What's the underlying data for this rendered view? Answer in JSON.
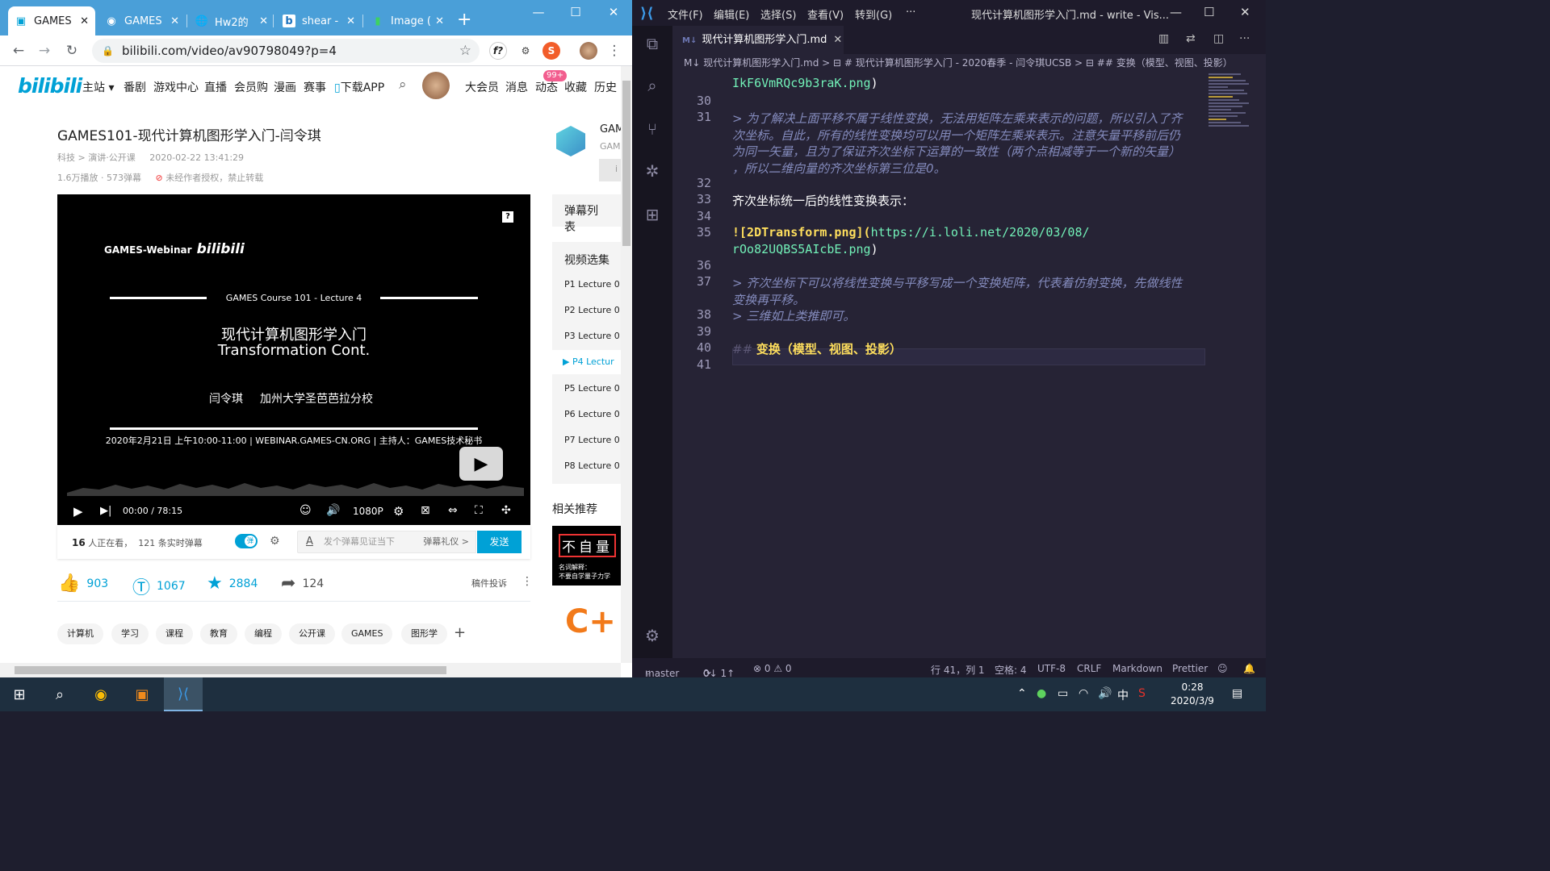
{
  "browser": {
    "tabs": [
      {
        "label": "GAMES",
        "icon": "bilibili-icon",
        "active": true
      },
      {
        "label": "GAMES",
        "icon": "eye-icon"
      },
      {
        "label": "Hw2的",
        "icon": "globe-icon"
      },
      {
        "label": "shear -",
        "icon": "bing-icon"
      },
      {
        "label": "Image (",
        "icon": "chart-icon"
      }
    ],
    "url": "bilibili.com/video/av90798049?p=4",
    "ext_f": "f?",
    "ext_s": "S"
  },
  "site": {
    "logo": "bilibili",
    "nav": [
      "主站",
      "番剧",
      "游戏中心",
      "直播",
      "会员购",
      "漫画",
      "赛事",
      "下载APP"
    ],
    "right_nav": [
      "大会员",
      "消息",
      "动态",
      "收藏",
      "历史"
    ],
    "badge": "99+"
  },
  "video": {
    "title": "GAMES101-现代计算机图形学入门-闫令琪",
    "category": "科技 > 演讲·公开课",
    "date": "2020-02-22 13:41:29",
    "stats": "1.6万播放 · 573弹幕",
    "warning": "未经作者授权，禁止转载"
  },
  "player": {
    "webinar": "GAMES-Webinar",
    "webinar_logo": "bilibili",
    "course": "GAMES Course 101 - Lecture 4",
    "title_cn": "现代计算机图形学入门",
    "title_en": "Transformation Cont.",
    "author": "闫令琪",
    "univ": "加州大学圣芭芭拉分校",
    "info": "2020年2月21日 上午10:00-11:00 | WEBINAR.GAMES-CN.ORG | 主持人：GAMES技术秘书",
    "time": "00:00 / 78:15",
    "quality": "1080P",
    "help": "?"
  },
  "danmaku": {
    "watching_count": "16",
    "watching_label": " 人正在看，",
    "realtime": "121 条实时弹幕",
    "toggle": "弹",
    "placeholder": "发个弹幕见证当下",
    "etiquette": "弹幕礼仪 >",
    "send": "发送"
  },
  "actions": {
    "like": "903",
    "coin": "1067",
    "fav": "2884",
    "share": "124",
    "report": "稿件投诉"
  },
  "tags": [
    "计算机",
    "学习",
    "课程",
    "教育",
    "编程",
    "公开课",
    "GAMES",
    "图形学"
  ],
  "sidebar": {
    "up_name": "GAM",
    "up_sub": "GAM",
    "follow": "i",
    "danmaku_list": "弹幕列表",
    "episodes_title": "视频选集",
    "episodes": [
      {
        "label": "P1  Lecture 0"
      },
      {
        "label": "P2  Lecture 0"
      },
      {
        "label": "P3  Lecture 0"
      },
      {
        "label": "▶ P4  Lectur",
        "current": true
      },
      {
        "label": "P5  Lecture 0"
      },
      {
        "label": "P6  Lecture 0"
      },
      {
        "label": "P7  Lecture 0"
      },
      {
        "label": "P8  Lecture 0"
      }
    ],
    "related": "相关推荐",
    "related_thumb_big": "不自量",
    "related_thumb_small": "名词解释：\n不要自学量子力学",
    "related_logo": "C+"
  },
  "vscode": {
    "menu": [
      "文件(F)",
      "编辑(E)",
      "选择(S)",
      "查看(V)",
      "转到(G)",
      "···"
    ],
    "window_title": "现代计算机图形学入门.md - write - Vis...",
    "tab": "现代计算机图形学入门.md",
    "tab_prefix": "M↓",
    "breadcrumb": "M↓ 现代计算机图形学入门.md > ⊟ # 现代计算机图形学入门 - 2020春季 - 闫令琪UCSB > ⊟ ## 变换（模型、视图、投影）",
    "lines": [
      {
        "n": "",
        "parts": [
          {
            "t": "IkF6VmRQc9b3raK.png",
            "c": "link"
          },
          {
            "t": ")",
            "c": "plain mono"
          }
        ]
      },
      {
        "n": "30",
        "parts": []
      },
      {
        "n": "31",
        "parts": [
          {
            "t": "> 为了解决上面平移不属于线性变换，无法用矩阵左乘来表示的问题，所以引入了齐",
            "c": "quote"
          }
        ]
      },
      {
        "n": "",
        "parts": [
          {
            "t": "次坐标。自此，所有的线性变换均可以用一个矩阵左乘来表示。注意矢量平移前后仍",
            "c": "quote"
          }
        ]
      },
      {
        "n": "",
        "parts": [
          {
            "t": "为同一矢量，且为了保证齐次坐标下运算的一致性（两个点相减等于一个新的矢量）",
            "c": "quote"
          }
        ]
      },
      {
        "n": "",
        "parts": [
          {
            "t": "，所以二维向量的齐次坐标第三位是0。",
            "c": "quote"
          }
        ]
      },
      {
        "n": "32",
        "parts": []
      },
      {
        "n": "33",
        "parts": [
          {
            "t": "齐次坐标统一后的线性变换表示：",
            "c": "plain"
          }
        ]
      },
      {
        "n": "34",
        "parts": []
      },
      {
        "n": "35",
        "parts": [
          {
            "t": "![2DTransform.png](",
            "c": "hdr mono"
          },
          {
            "t": "https://i.loli.net/2020/03/08/",
            "c": "link"
          }
        ]
      },
      {
        "n": "",
        "parts": [
          {
            "t": "rOo82UQBS5AIcbE.png",
            "c": "link"
          },
          {
            "t": ")",
            "c": "plain mono"
          }
        ]
      },
      {
        "n": "36",
        "parts": []
      },
      {
        "n": "37",
        "parts": [
          {
            "t": "> 齐次坐标下可以将线性变换与平移写成一个变换矩阵，代表着仿射变换，先做线性",
            "c": "quote"
          }
        ]
      },
      {
        "n": "",
        "parts": [
          {
            "t": "变换再平移。",
            "c": "quote"
          }
        ]
      },
      {
        "n": "38",
        "parts": [
          {
            "t": "> 三维如上类推即可。",
            "c": "quote"
          }
        ]
      },
      {
        "n": "39",
        "parts": []
      },
      {
        "n": "40",
        "parts": [
          {
            "t": "## ",
            "c": "hmark"
          },
          {
            "t": "变换（模型、视图、投影）",
            "c": "hdr"
          }
        ]
      },
      {
        "n": "41",
        "parts": []
      }
    ],
    "status": {
      "branch": "master",
      "sync": "0↓ 1↑",
      "problems": "⊗ 0 ⚠ 0",
      "position": "行 41，列 1",
      "spaces": "空格: 4",
      "encoding": "UTF-8",
      "eol": "CRLF",
      "language": "Markdown",
      "formatter": "Prettier"
    }
  },
  "taskbar": {
    "time": "0:28",
    "date": "2020/3/9",
    "ime": "中"
  }
}
